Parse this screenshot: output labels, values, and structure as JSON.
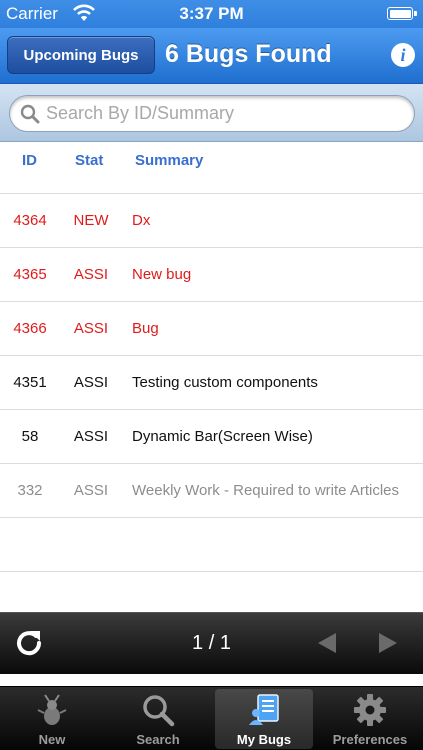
{
  "status_bar": {
    "carrier": "Carrier",
    "time": "3:37 PM"
  },
  "nav": {
    "back_label": "Upcoming Bugs",
    "title": "6 Bugs Found",
    "info_label": "i"
  },
  "search": {
    "placeholder": "Search By ID/Summary",
    "value": ""
  },
  "table": {
    "headers": {
      "id": "ID",
      "stat": "Stat",
      "summary": "Summary"
    },
    "rows": [
      {
        "id": "4364",
        "stat": "NEW",
        "summary": "Dx",
        "color": "#e01b1b"
      },
      {
        "id": "4365",
        "stat": "ASSI",
        "summary": "New bug",
        "color": "#e01b1b"
      },
      {
        "id": "4366",
        "stat": "ASSI",
        "summary": "Bug",
        "color": "#e01b1b"
      },
      {
        "id": "4351",
        "stat": "ASSI",
        "summary": "Testing custom components",
        "color": "#111111"
      },
      {
        "id": "58",
        "stat": "ASSI",
        "summary": "Dynamic Bar(Screen Wise)",
        "color": "#111111"
      },
      {
        "id": "332",
        "stat": "ASSI",
        "summary": "Weekly Work - Required to write Articles",
        "color": "#8d8d8d"
      }
    ]
  },
  "toolbar": {
    "page_indicator": "1 / 1"
  },
  "tabs": [
    {
      "label": "New",
      "icon": "bug-icon",
      "active": false
    },
    {
      "label": "Search",
      "icon": "magnifier-icon",
      "active": false
    },
    {
      "label": "My Bugs",
      "icon": "document-person-icon",
      "active": true
    },
    {
      "label": "Preferences",
      "icon": "gear-icon",
      "active": false
    }
  ],
  "colors": {
    "nav_blue": "#2e7cde",
    "header_blue": "#3a6fd0",
    "priority_red": "#e01b1b",
    "muted_gray": "#8d8d8d"
  }
}
